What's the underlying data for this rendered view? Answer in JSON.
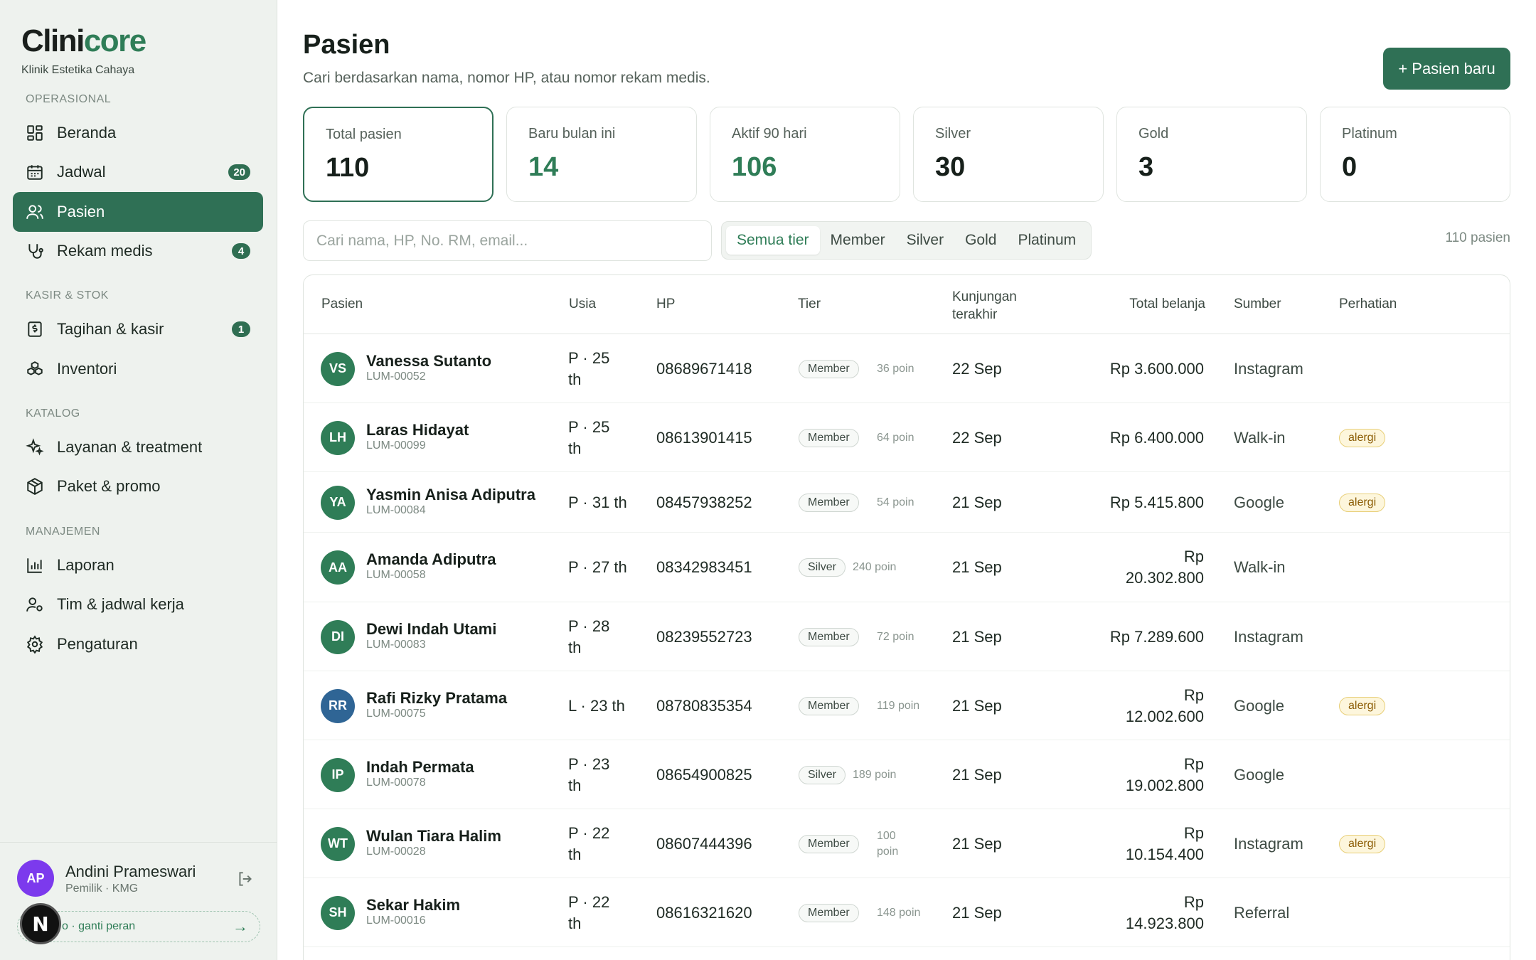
{
  "brand": {
    "name_a": "Clini",
    "name_b": "core",
    "clinic": "Klinik Estetika Cahaya"
  },
  "nav": {
    "sections": [
      "OPERASIONAL",
      "KASIR & STOK",
      "KATALOG",
      "MANAJEMEN"
    ],
    "items": [
      {
        "label": "Beranda",
        "icon": "grid-icon",
        "badge": ""
      },
      {
        "label": "Jadwal",
        "icon": "calendar-icon",
        "badge": "20"
      },
      {
        "label": "Pasien",
        "icon": "users-icon",
        "badge": ""
      },
      {
        "label": "Rekam medis",
        "icon": "stethoscope-icon",
        "badge": "4"
      },
      {
        "label": "Tagihan & kasir",
        "icon": "receipt-icon",
        "badge": "1"
      },
      {
        "label": "Inventori",
        "icon": "boxes-icon",
        "badge": ""
      },
      {
        "label": "Layanan & treatment",
        "icon": "sparkle-icon",
        "badge": ""
      },
      {
        "label": "Paket & promo",
        "icon": "package-icon",
        "badge": ""
      },
      {
        "label": "Laporan",
        "icon": "chart-icon",
        "badge": ""
      },
      {
        "label": "Tim & jadwal kerja",
        "icon": "user-cog-icon",
        "badge": ""
      },
      {
        "label": "Pengaturan",
        "icon": "gear-icon",
        "badge": ""
      }
    ],
    "active": "Pasien"
  },
  "user": {
    "initials": "AP",
    "name": "Andini Prameswari",
    "role": "Pemilik · KMG",
    "switch_label": "o · ganti peran",
    "switch_arrow": "→",
    "n_badge": "N"
  },
  "header": {
    "title": "Pasien",
    "subtitle": "Cari berdasarkan nama, nomor HP, atau nomor rekam medis.",
    "new_button": "+ Pasien baru"
  },
  "stats": [
    {
      "label": "Total pasien",
      "value": "110"
    },
    {
      "label": "Baru bulan ini",
      "value": "14"
    },
    {
      "label": "Aktif 90 hari",
      "value": "106"
    },
    {
      "label": "Silver",
      "value": "30"
    },
    {
      "label": "Gold",
      "value": "3"
    },
    {
      "label": "Platinum",
      "value": "0"
    }
  ],
  "search": {
    "placeholder": "Cari nama, HP, No. RM, email..."
  },
  "tiers": [
    "Semua tier",
    "Member",
    "Silver",
    "Gold",
    "Platinum"
  ],
  "count_label": "110 pasien",
  "table": {
    "columns": [
      "Pasien",
      "Usia",
      "HP",
      "Tier",
      "Kunjungan",
      "terakhir",
      "Total belanja",
      "Sumber",
      "Perhatian"
    ],
    "rows": [
      {
        "initials": "VS",
        "color": "#2f7d57",
        "name": "Vanessa Sutanto",
        "rm": "LUM-00052",
        "age": "P · 25 th",
        "hp": "08689671418",
        "tier": "Member",
        "poin": "36 poin",
        "visit": "22 Sep",
        "total": "Rp 3.600.000",
        "source": "Instagram",
        "flag": ""
      },
      {
        "initials": "LH",
        "color": "#2f7d57",
        "name": "Laras Hidayat",
        "rm": "LUM-00099",
        "age": "P · 25 th",
        "hp": "08613901415",
        "tier": "Member",
        "poin": "64 poin",
        "visit": "22 Sep",
        "total": "Rp 6.400.000",
        "source": "Walk-in",
        "flag": "alergi"
      },
      {
        "initials": "YA",
        "color": "#2f7d57",
        "name": "Yasmin Anisa Adiputra",
        "rm": "LUM-00084",
        "age": "P · 31 th",
        "hp": "08457938252",
        "tier": "Member",
        "poin": "54 poin",
        "visit": "21 Sep",
        "total": "Rp 5.415.800",
        "source": "Google",
        "flag": "alergi"
      },
      {
        "initials": "AA",
        "color": "#2f7d57",
        "name": "Amanda Adiputra",
        "rm": "LUM-00058",
        "age": "P · 27 th",
        "hp": "08342983451",
        "tier": "Silver",
        "poin": "240 poin",
        "visit": "21 Sep",
        "total": "Rp 20.302.800",
        "source": "Walk-in",
        "flag": ""
      },
      {
        "initials": "DI",
        "color": "#2f7d57",
        "name": "Dewi Indah Utami",
        "rm": "LUM-00083",
        "age": "P · 28 th",
        "hp": "08239552723",
        "tier": "Member",
        "poin": "72 poin",
        "visit": "21 Sep",
        "total": "Rp 7.289.600",
        "source": "Instagram",
        "flag": ""
      },
      {
        "initials": "RR",
        "color": "#2f6595",
        "name": "Rafi Rizky Pratama",
        "rm": "LUM-00075",
        "age": "L · 23 th",
        "hp": "08780835354",
        "tier": "Member",
        "poin": "119 poin",
        "visit": "21 Sep",
        "total": "Rp 12.002.600",
        "source": "Google",
        "flag": "alergi"
      },
      {
        "initials": "IP",
        "color": "#2f7d57",
        "name": "Indah Permata",
        "rm": "LUM-00078",
        "age": "P · 23 th",
        "hp": "08654900825",
        "tier": "Silver",
        "poin": "189 poin",
        "visit": "21 Sep",
        "total": "Rp 19.002.800",
        "source": "Google",
        "flag": ""
      },
      {
        "initials": "WT",
        "color": "#2f7d57",
        "name": "Wulan Tiara Halim",
        "rm": "LUM-00028",
        "age": "P · 22 th",
        "hp": "08607444396",
        "tier": "Member",
        "poin": "100 poin",
        "visit": "21 Sep",
        "total": "Rp 10.154.400",
        "source": "Instagram",
        "flag": "alergi"
      },
      {
        "initials": "SH",
        "color": "#2f7d57",
        "name": "Sekar Hakim",
        "rm": "LUM-00016",
        "age": "P · 22 th",
        "hp": "08616321620",
        "tier": "Member",
        "poin": "148 poin",
        "visit": "21 Sep",
        "total": "Rp 14.923.800",
        "source": "Referral",
        "flag": ""
      }
    ]
  },
  "colors": {
    "accent": "#2f7055",
    "accent_text": "#2f7d57",
    "flag_bg": "#fdf6dc",
    "user_avatar": "#7c3aed"
  }
}
